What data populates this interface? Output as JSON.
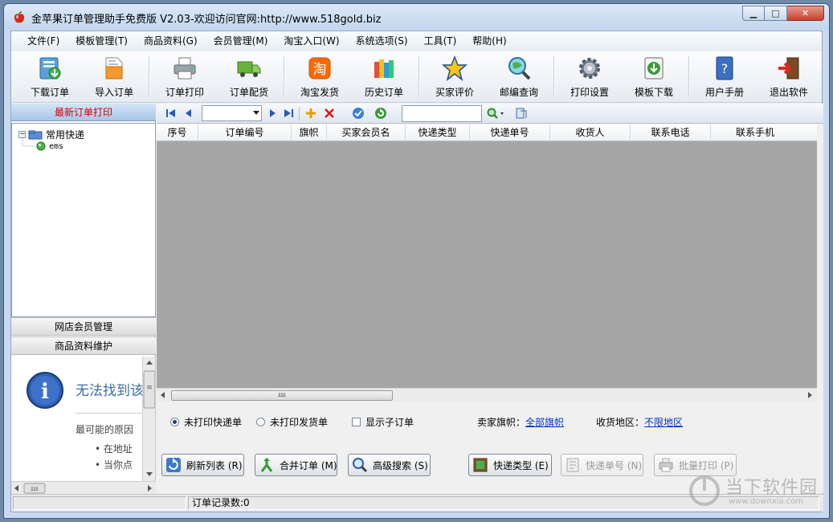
{
  "window": {
    "title": "金苹果订单管理助手免费版 V2.03-欢迎访问官网:http://www.518gold.biz",
    "minimize": "▁",
    "maximize": "□",
    "close": "✕"
  },
  "menu": [
    "文件(F)",
    "模板管理(T)",
    "商品资料(G)",
    "会员管理(M)",
    "淘宝入口(W)",
    "系统选项(S)",
    "工具(T)",
    "帮助(H)"
  ],
  "toolbar": [
    {
      "label": "下载订单",
      "icon": "download-orders-icon"
    },
    {
      "label": "导入订单",
      "icon": "import-orders-icon"
    },
    {
      "label": "订单打印",
      "icon": "printer-icon"
    },
    {
      "label": "订单配货",
      "icon": "truck-icon"
    },
    {
      "label": "淘宝发货",
      "icon": "taobao-icon",
      "glyph": "淘"
    },
    {
      "label": "历史订单",
      "icon": "books-icon"
    },
    {
      "label": "买家评价",
      "icon": "star-icon"
    },
    {
      "label": "邮编查询",
      "icon": "magnifier-globe-icon"
    },
    {
      "label": "打印设置",
      "icon": "gear-icon"
    },
    {
      "label": "模板下载",
      "icon": "download-template-icon"
    },
    {
      "label": "用户手册",
      "icon": "manual-icon",
      "glyph": "?"
    },
    {
      "label": "退出软件",
      "icon": "exit-icon"
    }
  ],
  "left": {
    "header": "最新订单打印",
    "tree": {
      "root": "常用快递",
      "root_toggle": "−",
      "child": "ems"
    },
    "sections": [
      "网店会员管理",
      "商品资料维护"
    ],
    "error": {
      "title": "无法找到该",
      "cause": "最可能的原因",
      "bullets": [
        "在地址",
        "当你点"
      ],
      "icon_glyph": "i",
      "bullet_glyph": "•"
    },
    "scroll_grip": "≡",
    "hscroll_grip": "⅏"
  },
  "navbar": {
    "search_value": ""
  },
  "grid": {
    "columns": [
      "序号",
      "订单编号",
      "旗帜",
      "买家会员名",
      "快递类型",
      "快递单号",
      "收货人",
      "联系电话",
      "联系手机"
    ],
    "rows": [],
    "hscroll_grip": "⅏"
  },
  "filters": {
    "radio_unprinted_express": "未打印快递单",
    "radio_unprinted_invoice": "未打印发货单",
    "check_show_sub": "显示子订单",
    "seller_flag_label": "卖家旗帜：",
    "seller_flag_value": "全部旗帜",
    "region_label": "收货地区：",
    "region_value": "不限地区"
  },
  "actions": [
    {
      "label": "刷新列表 (R)",
      "icon": "refresh-icon",
      "enabled": true
    },
    {
      "label": "合并订单 (M)",
      "icon": "merge-icon",
      "enabled": true
    },
    {
      "label": "高级搜索 (S)",
      "icon": "search-icon",
      "enabled": true
    },
    {
      "label": "快递类型 (E)",
      "icon": "express-type-icon",
      "enabled": true
    },
    {
      "label": "快递单号 (N)",
      "icon": "waybill-icon",
      "enabled": false
    },
    {
      "label": "批量打印 (P)",
      "icon": "batch-print-icon",
      "enabled": false
    }
  ],
  "status": {
    "records": "订单记录数:0"
  },
  "watermark": {
    "text": "当下软件园",
    "url": "www.downxia.com"
  }
}
